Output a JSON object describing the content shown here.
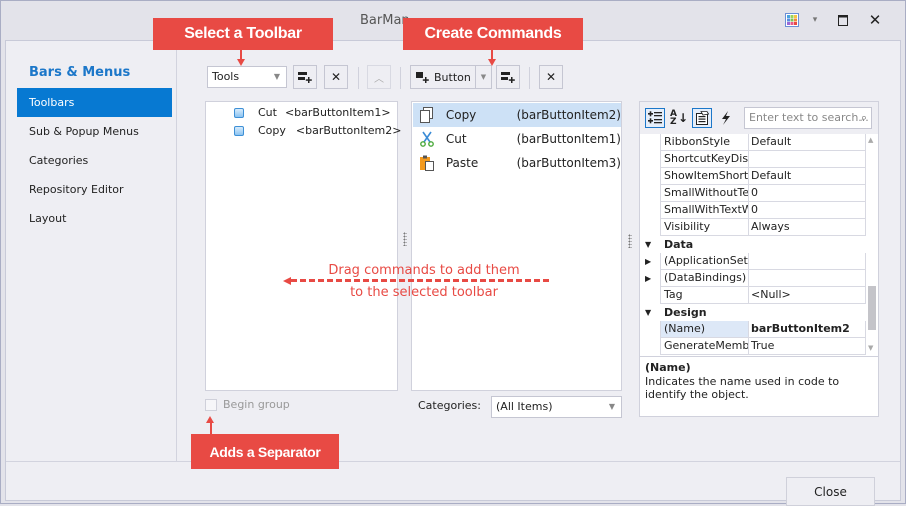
{
  "window": {
    "title": "BarMan",
    "controls": {
      "skin_icon": "skin-palette-icon",
      "dropdown": "▾",
      "maximize": "▭",
      "close": "✕"
    }
  },
  "nav": {
    "header": "Bars & Menus",
    "items": [
      {
        "label": "Toolbars",
        "active": true
      },
      {
        "label": "Sub & Popup Menus",
        "active": false
      },
      {
        "label": "Categories",
        "active": false
      },
      {
        "label": "Repository Editor",
        "active": false
      },
      {
        "label": "Layout",
        "active": false
      }
    ]
  },
  "toolbar": {
    "toolbar_select": "Tools",
    "new_item_type": "Button"
  },
  "toolbar_items": [
    {
      "label": "Cut",
      "item": "<barButtonItem1>"
    },
    {
      "label": "Copy",
      "item": "<barButtonItem2>"
    }
  ],
  "commands": [
    {
      "label": "Copy",
      "item": "(barButtonItem2)",
      "icon": "copy-icon",
      "selected": true
    },
    {
      "label": "Cut",
      "item": "(barButtonItem1)",
      "icon": "scissors-icon",
      "selected": false
    },
    {
      "label": "Paste",
      "item": "(barButtonItem3)",
      "icon": "paste-icon",
      "selected": false
    }
  ],
  "begin_group": {
    "label": "Begin group",
    "checked": false
  },
  "categories": {
    "label": "Categories:",
    "value": "(All Items)"
  },
  "property_grid": {
    "search_placeholder": "Enter text to search...",
    "rows": [
      {
        "type": "prop",
        "name": "RibbonStyle",
        "value": "Default"
      },
      {
        "type": "prop",
        "name": "ShortcutKeyDisplayString",
        "value": ""
      },
      {
        "type": "prop",
        "name": "ShowItemShortcut",
        "value": "Default"
      },
      {
        "type": "prop",
        "name": "SmallWithoutTextWidth",
        "value": "0"
      },
      {
        "type": "prop",
        "name": "SmallWithTextWidth",
        "value": "0"
      },
      {
        "type": "prop",
        "name": "Visibility",
        "value": "Always"
      },
      {
        "type": "category",
        "name": "Data"
      },
      {
        "type": "prop",
        "name": "(ApplicationSettings)",
        "value": "",
        "expandable": true
      },
      {
        "type": "prop",
        "name": "(DataBindings)",
        "value": "",
        "expandable": true
      },
      {
        "type": "prop",
        "name": "Tag",
        "value": "<Null>"
      },
      {
        "type": "category",
        "name": "Design"
      },
      {
        "type": "prop",
        "name": "(Name)",
        "value": "barButtonItem2",
        "selected": true
      },
      {
        "type": "prop",
        "name": "GenerateMember",
        "value": "True"
      }
    ],
    "description_title": "(Name)",
    "description_text": "Indicates the name used in code to identify the object."
  },
  "footer": {
    "close_label": "Close"
  },
  "annotations": {
    "select_toolbar": "Select a Toolbar",
    "create_commands": "Create Commands",
    "adds_separator": "Adds a Separator",
    "drag_hint_line1": "Drag commands to add them",
    "drag_hint_line2": "to the selected toolbar"
  },
  "colors": {
    "accent": "#0779d2",
    "callout": "#e84a44",
    "selection": "#cde1f6"
  }
}
